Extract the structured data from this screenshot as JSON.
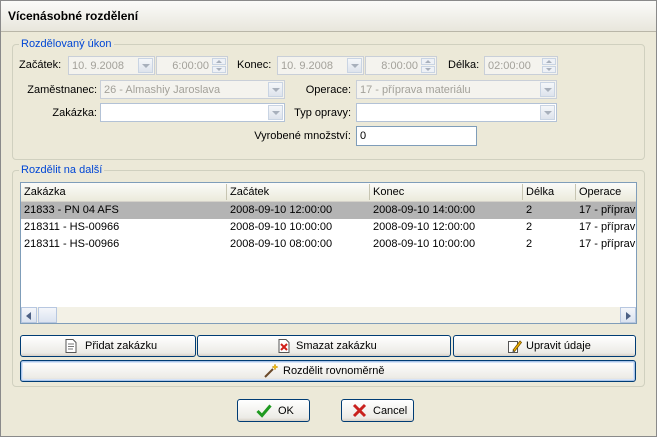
{
  "window": {
    "title": "Vícenásobné rozdělení"
  },
  "group1": {
    "legend": "Rozdělovaný úkon",
    "start_label": "Začátek:",
    "start_date": "10. 9.2008",
    "start_time": "6:00:00",
    "end_label": "Konec:",
    "end_date": "10. 9.2008",
    "end_time": "8:00:00",
    "duration_label": "Délka:",
    "duration": "02:00:00",
    "employee_label": "Zaměstnanec:",
    "employee": "26 - Almashiy Jaroslava",
    "operation_label": "Operace:",
    "operation": "17 - příprava materiálu",
    "order_label": "Zakázka:",
    "order": "",
    "repair_label": "Typ opravy:",
    "repair": "",
    "qty_label": "Vyrobené množství:",
    "qty": "0"
  },
  "group2": {
    "legend": "Rozdělit na další",
    "columns": [
      "Zakázka",
      "Začátek",
      "Konec",
      "Délka",
      "Operace"
    ],
    "rows": [
      {
        "order": "21833 - PN 04 AFS",
        "start": "2008-09-10 12:00:00",
        "end": "2008-09-10 14:00:00",
        "duration": "2",
        "operation": "17 - příprav"
      },
      {
        "order": "218311 - HS-00966",
        "start": "2008-09-10 10:00:00",
        "end": "2008-09-10 12:00:00",
        "duration": "2",
        "operation": "17 - příprav"
      },
      {
        "order": "218311 - HS-00966",
        "start": "2008-09-10 08:00:00",
        "end": "2008-09-10 10:00:00",
        "duration": "2",
        "operation": "17 - příprav"
      }
    ],
    "add_button": "Přidat zakázku",
    "delete_button": "Smazat zakázku",
    "edit_button": "Upravit údaje",
    "split_button": "Rozdělit rovnoměrně"
  },
  "footer": {
    "ok": "OK",
    "cancel": "Cancel"
  },
  "colors": {
    "legend": "#0046d5",
    "selected_row": "#b4b4b4",
    "button_border": "#003c74"
  }
}
